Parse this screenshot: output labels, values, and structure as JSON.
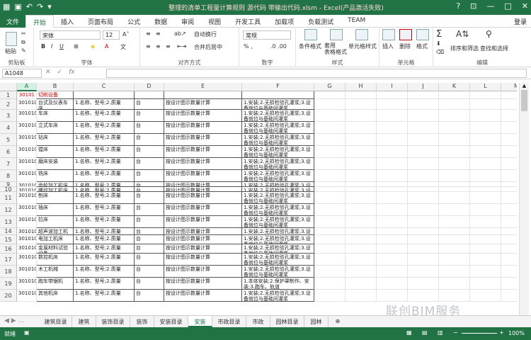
{
  "window": {
    "title": "整理的清单工程量计算规则 源代码 带输出代码.xlsm - Excel(产品激活失败)",
    "help": "?",
    "minimize": "—",
    "restore": "□",
    "close": "✕"
  },
  "ribbon_tabs": [
    "文件",
    "开始",
    "插入",
    "页面布局",
    "公式",
    "数据",
    "审阅",
    "视图",
    "开发工具",
    "加载项",
    "负载测试",
    "TEAM"
  ],
  "user": "登录",
  "ribbon": {
    "paste": "粘贴",
    "font_name": "宋体",
    "font_size": "12",
    "wrap": "自动换行",
    "merge": "合并后居中",
    "number_format": "常规",
    "cond_format": "条件格式",
    "table_format": "套用\n表格格式",
    "cell_style": "单元格样式",
    "insert": "插入",
    "delete": "删除",
    "format": "格式",
    "sort": "排序和筛选",
    "find": "查找和选择",
    "groups": {
      "clipboard": "剪贴板",
      "font": "字体",
      "align": "对齐方式",
      "number": "数字",
      "style": "样式",
      "cells": "单元格",
      "edit": "编辑"
    }
  },
  "formula_bar": {
    "name_box": "A1048",
    "fx": "fx",
    "cancel": "✕",
    "enter": "✓",
    "value": ""
  },
  "columns": [
    "A",
    "B",
    "C",
    "D",
    "E",
    "F",
    "G",
    "H",
    "I",
    "J",
    "K",
    "L",
    "M"
  ],
  "rows": [
    {
      "n": "1",
      "a": "30101",
      "b": "切削设备",
      "c": "",
      "d": "",
      "e": "",
      "f": ""
    },
    {
      "n": "2",
      "a": "30101001",
      "b": "台式及仪表车床",
      "c": "1.名称、型号;2.质量",
      "d": "台",
      "e": "按设计图示数量计算",
      "f": "1.安装;2.无损检验孔灌浆;3.设备就位与基础间灌浆"
    },
    {
      "n": "3",
      "a": "30101002",
      "b": "车床",
      "c": "1.名称、型号;2.质量",
      "d": "台",
      "e": "按设计图示数量计算",
      "f": "1.安装;2.无损检验孔灌浆;3.设备就位与基础间灌浆"
    },
    {
      "n": "4",
      "a": "30101003",
      "b": "立式车床",
      "c": "1.名称、型号;2.质量",
      "d": "台",
      "e": "按设计图示数量计算",
      "f": "1.安装;2.无损检验孔灌浆;3.设备就位与基础间灌浆"
    },
    {
      "n": "5",
      "a": "30101004",
      "b": "钻床",
      "c": "1.名称、型号;2.质量",
      "d": "台",
      "e": "按设计图示数量计算",
      "f": "1.安装;2.无损检验孔灌浆;3.设备就位与基础间灌浆"
    },
    {
      "n": "6",
      "a": "30101005",
      "b": "镗床",
      "c": "1.名称、型号;2.质量",
      "d": "台",
      "e": "按设计图示数量计算",
      "f": "1.安装;2.无损检验孔灌浆;3.设备就位与基础间灌浆"
    },
    {
      "n": "7",
      "a": "30101006",
      "b": "磨床安装",
      "c": "1.名称、型号;2.质量",
      "d": "台",
      "e": "按设计图示数量计算",
      "f": "1.安装;2.无损检验孔灌浆;3.设备就位与基础间灌浆"
    },
    {
      "n": "8",
      "a": "30101007",
      "b": "铣床",
      "c": "1.名称、型号;2.质量",
      "d": "台",
      "e": "按设计图示数量计算",
      "f": "1.安装;2.无损检验孔灌浆;3.设备就位与基础间灌浆"
    },
    {
      "n": "9",
      "a": "30101008",
      "b": "齿轮加工机床",
      "c": "1.名称、型号;2.质量",
      "d": "台",
      "e": "按设计图示数量计算",
      "f": "1.安装;2.无损检验孔灌浆;3.设备就位与基础间灌浆"
    },
    {
      "n": "10",
      "a": "30101009",
      "b": "螺纹加工机床",
      "c": "1.名称、型号;2.质量",
      "d": "台",
      "e": "按设计图示数量计算",
      "f": "1.安装;2.无损检验孔灌浆;3.设备就位与基础间灌浆"
    },
    {
      "n": "11",
      "a": "30101010",
      "b": "刨床",
      "c": "1.名称、型号;2.质量",
      "d": "台",
      "e": "按设计图示数量计算",
      "f": "1.安装;2.无损检验孔灌浆;3.设备就位与基础间灌浆"
    },
    {
      "n": "12",
      "a": "30101011",
      "b": "插床",
      "c": "1.名称、型号;2.质量",
      "d": "台",
      "e": "按设计图示数量计算",
      "f": "1.安装;2.无损检验孔灌浆;3.设备就位与基础间灌浆"
    },
    {
      "n": "13",
      "a": "30101012",
      "b": "拉床",
      "c": "1.名称、型号;2.质量",
      "d": "台",
      "e": "按设计图示数量计算",
      "f": "1.安装;2.无损检验孔灌浆;3.设备就位与基础间灌浆"
    },
    {
      "n": "14",
      "a": "30101013",
      "b": "超声波加工机床",
      "c": "1.名称、型号;2.质量",
      "d": "台",
      "e": "按设计图示数量计算",
      "f": "1.安装;2.无损检验孔灌浆;3.设备就位与基础间灌浆"
    },
    {
      "n": "15",
      "a": "30101014",
      "b": "电加工机床",
      "c": "1.名称、型号;2.质量",
      "d": "台",
      "e": "按设计图示数量计算",
      "f": "1.安装;2.无损检验孔灌浆;3.设备就位与基础间灌浆"
    },
    {
      "n": "16",
      "a": "30101015",
      "b": "金属材料试验设备",
      "c": "1.名称、型号;2.质量",
      "d": "台",
      "e": "按设计图示数量计算",
      "f": "1.安装;2.无损检验孔灌浆;3.设备就位与基础间灌浆"
    },
    {
      "n": "17",
      "a": "30101016",
      "b": "数控机床",
      "c": "1.名称、型号;2.质量",
      "d": "台",
      "e": "按设计图示数量计算",
      "f": "1.安装;2.无损检验孔灌浆;3.设备就位与基础间灌浆"
    },
    {
      "n": "18",
      "a": "30101017",
      "b": "木工机械",
      "c": "1.名称、型号;2.质量",
      "d": "台",
      "e": "按设计图示数量计算",
      "f": "1.安装;2.无损检验孔灌浆;3.设备就位与基础间灌浆"
    },
    {
      "n": "19",
      "a": "30101018",
      "b": "跑车带锯机",
      "c": "1.名称、型号;2.质量",
      "d": "台",
      "e": "按设计图示数量计算",
      "f": "1.本体安装;2.保护罩制作、安装;3.跑车、轨道"
    },
    {
      "n": "20",
      "a": "30101019",
      "b": "其他机床",
      "c": "1.名称、型号;2.质量",
      "d": "台",
      "e": "按设计图示数量计算",
      "f": "1.安装;2.无损检验孔灌浆;3.设备就位与基础间灌浆"
    }
  ],
  "sheets": [
    "建筑目录",
    "建筑",
    "装饰目录",
    "装饰",
    "安装目录",
    "安装",
    "市政目录",
    "市政",
    "园林目录",
    "园林"
  ],
  "active_sheet": "安装",
  "status": {
    "ready": "就绪",
    "zoom": "100%"
  },
  "watermark": "联创BIM服务",
  "colors": {
    "excel_green": "#217346",
    "red_text": "#cc0000"
  }
}
